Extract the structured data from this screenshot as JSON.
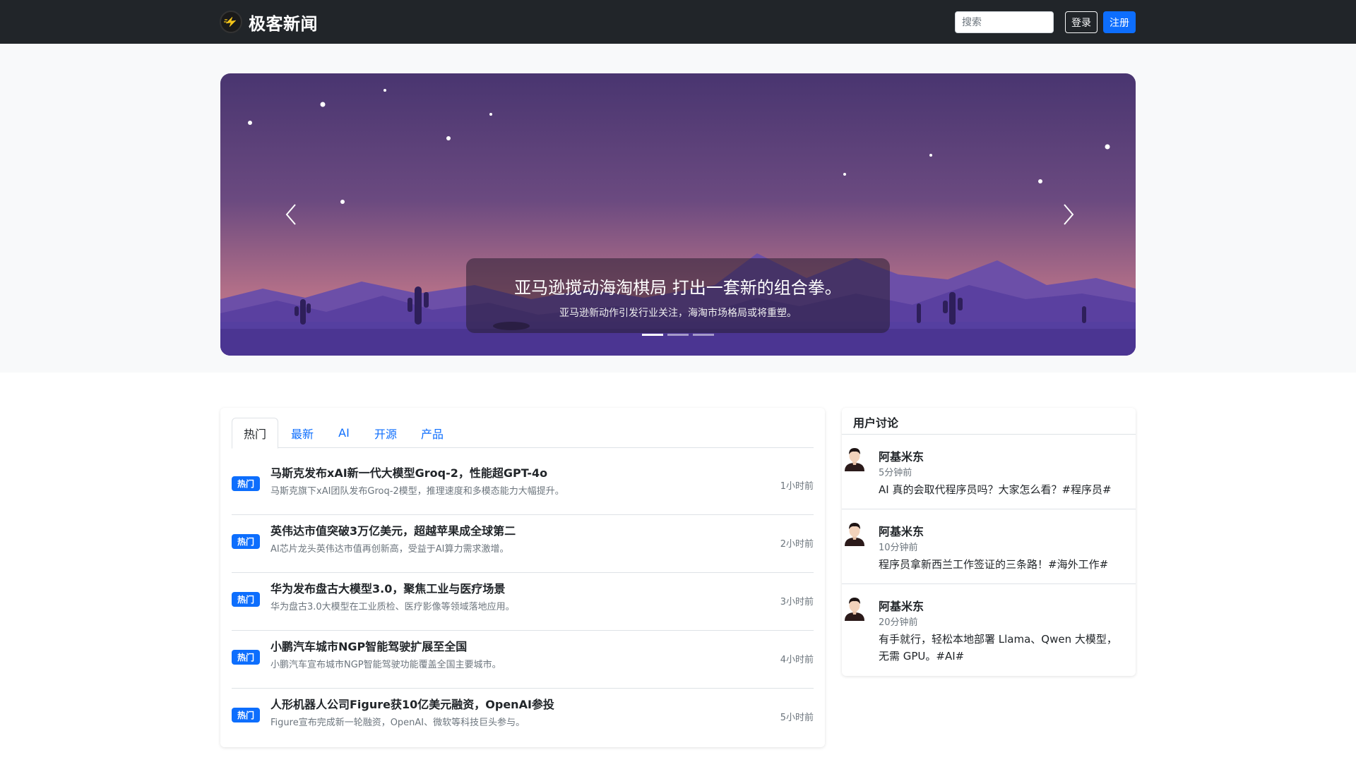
{
  "navbar": {
    "brand": "极客新闻",
    "logo_icon": "lightning-bolt-icon",
    "search_placeholder": "搜索",
    "login_label": "登录",
    "register_label": "注册"
  },
  "carousel": {
    "title": "亚马逊搅动海淘棋局 打出一套新的组合拳。",
    "subtitle": "亚马逊新动作引发行业关注，海淘市场格局或将重塑。",
    "slide_count": 3,
    "active_slide": 1,
    "prev_icon": "chevron-left-icon",
    "next_icon": "chevron-right-icon"
  },
  "news": {
    "tabs": [
      {
        "label": "热门",
        "active": true
      },
      {
        "label": "最新",
        "active": false
      },
      {
        "label": "AI",
        "active": false
      },
      {
        "label": "开源",
        "active": false
      },
      {
        "label": "产品",
        "active": false
      }
    ],
    "items": [
      {
        "badge": "热门",
        "title": "马斯克发布xAI新一代大模型Groq-2，性能超GPT-4o",
        "desc": "马斯克旗下xAI团队发布Groq-2模型，推理速度和多模态能力大幅提升。",
        "time": "1小时前"
      },
      {
        "badge": "热门",
        "title": "英伟达市值突破3万亿美元，超越苹果成全球第二",
        "desc": "AI芯片龙头英伟达市值再创新高，受益于AI算力需求激增。",
        "time": "2小时前"
      },
      {
        "badge": "热门",
        "title": "华为发布盘古大模型3.0，聚焦工业与医疗场景",
        "desc": "华为盘古3.0大模型在工业质检、医疗影像等领域落地应用。",
        "time": "3小时前"
      },
      {
        "badge": "热门",
        "title": "小鹏汽车城市NGP智能驾驶扩展至全国",
        "desc": "小鹏汽车宣布城市NGP智能驾驶功能覆盖全国主要城市。",
        "time": "4小时前"
      },
      {
        "badge": "热门",
        "title": "人形机器人公司Figure获10亿美元融资，OpenAI参投",
        "desc": "Figure宣布完成新一轮融资，OpenAI、微软等科技巨头参与。",
        "time": "5小时前"
      }
    ]
  },
  "discussion": {
    "header": "用户讨论",
    "items": [
      {
        "user": "阿基米东",
        "time": "5分钟前",
        "text": "AI 真的会取代程序员吗？大家怎么看？#程序员#"
      },
      {
        "user": "阿基米东",
        "time": "10分钟前",
        "text": "程序员拿新西兰工作签证的三条路！#海外工作#"
      },
      {
        "user": "阿基米东",
        "time": "20分钟前",
        "text": "有手就行，轻松本地部署 Llama、Qwen 大模型，无需 GPU。#AI#"
      }
    ]
  },
  "colors": {
    "navbar_bg": "#212529",
    "primary": "#0d6efd",
    "muted": "#6c757d",
    "sky_top": "#4a3570",
    "sky_bottom": "#c47a8e"
  }
}
